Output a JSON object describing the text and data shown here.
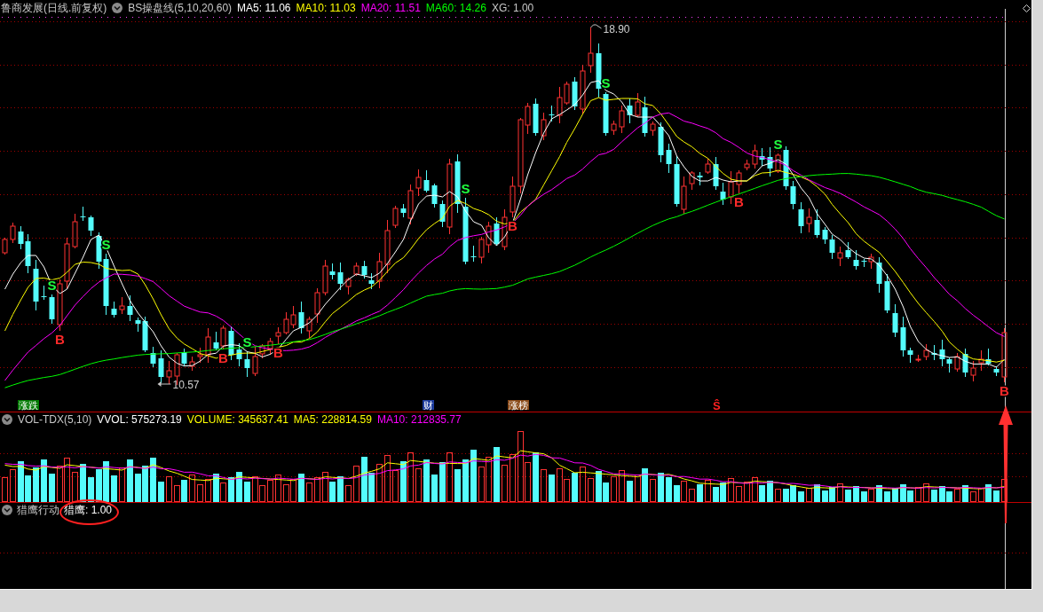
{
  "main_panel": {
    "title": "鲁商发展(日线.前复权)",
    "indicator": "BS操盘线(5,10,20,60)",
    "legend": [
      {
        "text": "MA5: 11.06",
        "color": "#ffffff",
        "kind": "line"
      },
      {
        "text": "MA10: 11.03",
        "color": "#ffff00",
        "kind": "line"
      },
      {
        "text": "MA20: 11.51",
        "color": "#ff00ff",
        "kind": "line"
      },
      {
        "text": "MA60: 14.26",
        "color": "#00ff00",
        "kind": "line"
      },
      {
        "text": "XG: 1.00",
        "color": "#c8c8c8",
        "kind": "value"
      }
    ],
    "high_label": "18.90",
    "low_label": "10.57",
    "signals": [
      {
        "label": "S",
        "kind": "sell"
      },
      {
        "label": "B",
        "kind": "buy"
      },
      {
        "label": "S",
        "kind": "sell"
      },
      {
        "label": "B",
        "kind": "buy"
      },
      {
        "label": "S",
        "kind": "sell"
      },
      {
        "label": "B",
        "kind": "buy"
      },
      {
        "label": "S",
        "kind": "sell"
      },
      {
        "label": "B",
        "kind": "buy"
      },
      {
        "label": "S",
        "kind": "sell"
      },
      {
        "label": "B",
        "kind": "buy"
      },
      {
        "label": "S",
        "kind": "sell"
      },
      {
        "label": "B",
        "kind": "buy"
      }
    ],
    "events": [
      {
        "label": "涨跌",
        "kind": "tag",
        "color": "#007a00"
      },
      {
        "label": "财",
        "kind": "tag",
        "color": "#1e3c9c"
      },
      {
        "label": "涨榜",
        "kind": "tag",
        "color": "#8a4a18"
      },
      {
        "label": "Ŝ",
        "kind": "mark",
        "color": "#ff2020"
      }
    ]
  },
  "volume_panel": {
    "indicator": "VOL-TDX(5,10)",
    "legend": [
      {
        "text": "VVOL: 575273.19",
        "color": "#ffffff",
        "kind": "value"
      },
      {
        "text": "VOLUME: 345637.41",
        "color": "#ffff00",
        "kind": "value"
      },
      {
        "text": "MA5: 228814.59",
        "color": "#ffff00",
        "kind": "line"
      },
      {
        "text": "MA10: 212835.77",
        "color": "#ff00ff",
        "kind": "line"
      }
    ]
  },
  "falcon_panel": {
    "indicator": "猎鹰行动",
    "legend": [
      {
        "text": "猎鹰: 1.00",
        "color": "#ffffff",
        "kind": "value",
        "circled": true
      }
    ]
  },
  "arrow_to_last_bar": true
}
